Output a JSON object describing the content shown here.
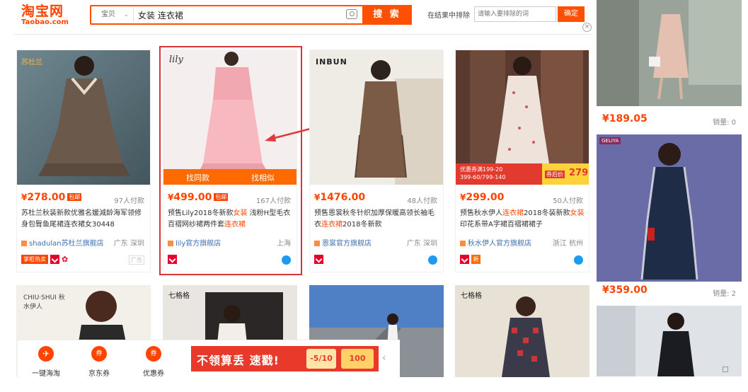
{
  "header": {
    "logo_cn": "淘宝网",
    "logo_en": "Taobao.com",
    "search_category": "宝贝",
    "search_query": "女装 连衣裙",
    "search_button": "搜 索",
    "within_label": "在结果中排除",
    "within_placeholder": "请输入要排除的词",
    "within_button": "确定"
  },
  "cards": [
    {
      "price_cur": "¥",
      "price": "278.00",
      "tag": "包邮",
      "sales": "97人付款",
      "title": "苏杜兰秋装新款优雅名媛減龄海军领修身包臀鱼尾裙连衣裙女30448",
      "shop": "shadulan苏杜兰旗舰店",
      "location": "广东 深圳",
      "badge": "掌柜热卖",
      "ad": "广告",
      "logo": "苏杜兰"
    },
    {
      "price_cur": "¥",
      "price": "499.00",
      "tag": "包邮",
      "sales": "167人付款",
      "title_a": "预售Lily2018冬新款",
      "title_hl1": "女装",
      "title_b": " 浅粉H型毛衣百褶网纱裙两件套",
      "title_hl2": "连衣裙",
      "shop": "lily官方旗舰店",
      "location": "上海",
      "find_same": "找同款",
      "find_similar": "找相似",
      "logo": "lily"
    },
    {
      "price_cur": "¥",
      "price": "1476.00",
      "sales": "48人付款",
      "title_a": "预售恩裳秋冬针织加厚保暖高领长袖毛衣",
      "title_hl": "连衣裙",
      "title_b": "2018冬新款",
      "shop": "恩裳官方旗舰店",
      "location": "广东 深圳",
      "logo": "INBUN"
    },
    {
      "price_cur": "¥",
      "price": "299.00",
      "sales": "50人付款",
      "title_a": "预售秋水伊人",
      "title_hl1": "连衣裙",
      "title_b": "2018冬装新款",
      "title_hl2": "女装",
      "title_c": "印花系带A字裙百褶裙裙子",
      "shop": "秋水伊人官方旗舰店",
      "location": "浙江 杭州",
      "promo1": "优惠券满199-20",
      "promo2": "399-60/799-140",
      "promo3": "券后价",
      "promo4": "279"
    }
  ],
  "right": [
    {
      "price": "¥189.05",
      "sales": "销量: 0"
    },
    {
      "price": "¥359.00",
      "sales": "销量: 2",
      "brand": "GELIYA"
    }
  ],
  "row2": [
    {
      "logo": "CHIU·SHUI 秋水伊人"
    },
    {
      "logo": "七格格"
    },
    {
      "logo": ""
    },
    {
      "logo": "七格格"
    }
  ],
  "bottom": {
    "items": [
      {
        "label": "一键海淘",
        "icon": "✈"
      },
      {
        "label": "京东券",
        "icon": "券"
      },
      {
        "label": "优惠券",
        "icon": "券"
      }
    ],
    "banner_text": "不领算丢 速戳!",
    "coupon1": "-5/10",
    "coupon2": "100"
  },
  "colors": {
    "accent": "#ff5000",
    "price": "#ff4400",
    "highlight_border": "#d9343a"
  }
}
